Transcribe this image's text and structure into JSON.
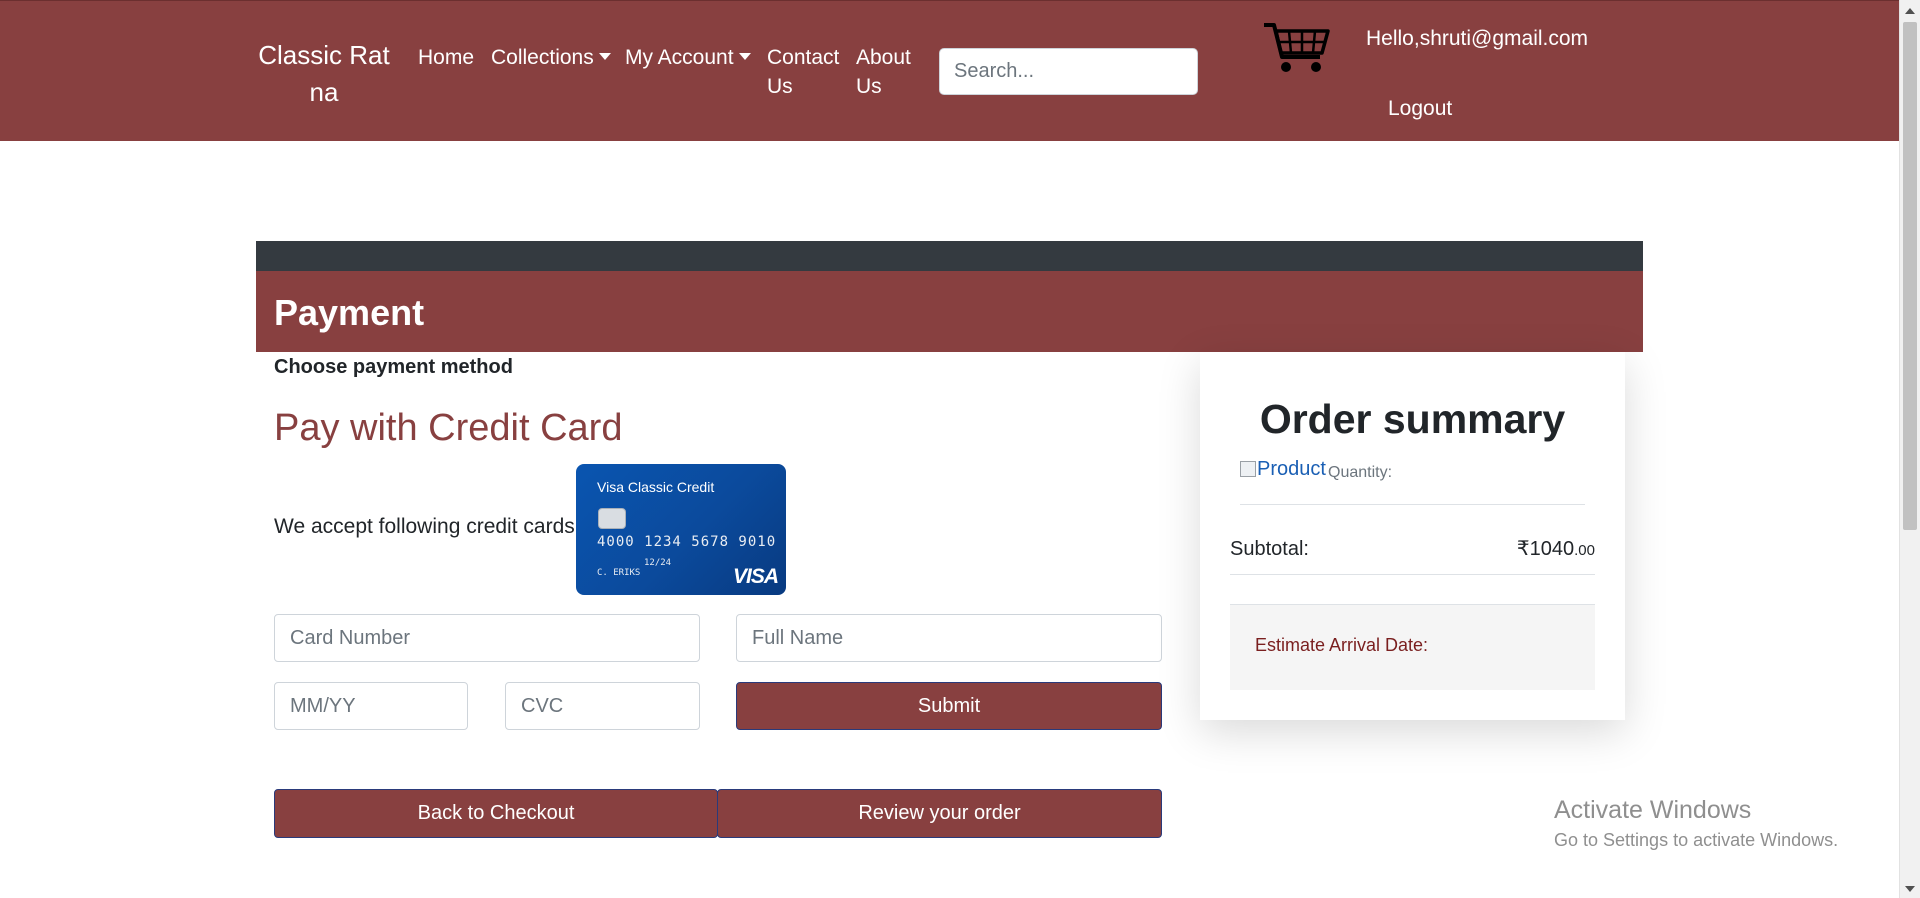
{
  "nav": {
    "brand": "Classic Ratna",
    "home": "Home",
    "collections": "Collections",
    "my_account": "My Account",
    "contact_us": "Contact Us",
    "about_us": "About Us",
    "search_placeholder": "Search...",
    "greeting": "Hello,shruti@gmail.com",
    "logout": "Logout",
    "cart_icon": "cart-icon"
  },
  "payment": {
    "title": "Payment",
    "choose_method": "Choose payment method",
    "credit_heading": "Pay with Credit Card",
    "accept_text": "We accept following credit cards:",
    "card_image": {
      "name": "Visa Classic Credit",
      "number": "4000 1234 5678 9010",
      "expiry": "12/24",
      "holder": "C. ERIKS",
      "brand": "VISA"
    },
    "card_number_placeholder": "Card Number",
    "full_name_placeholder": "Full Name",
    "expiry_placeholder": "MM/YY",
    "cvc_placeholder": "CVC",
    "submit": "Submit",
    "back_to_checkout": "Back to Checkout",
    "review_order": "Review your order"
  },
  "summary": {
    "title": "Order summary",
    "product_alt": "Product",
    "quantity_label": "Quantity:",
    "subtotal_label": "Subtotal:",
    "subtotal_main": "₹1040",
    "subtotal_cents": ".00",
    "estimate_label": "Estimate Arrival Date:"
  },
  "watermark": {
    "line1": "Activate Windows",
    "line2": "Go to Settings to activate Windows."
  },
  "colors": {
    "brand": "#884040",
    "dark_bar": "#343a40",
    "estimate_text": "#7a1f1f"
  }
}
